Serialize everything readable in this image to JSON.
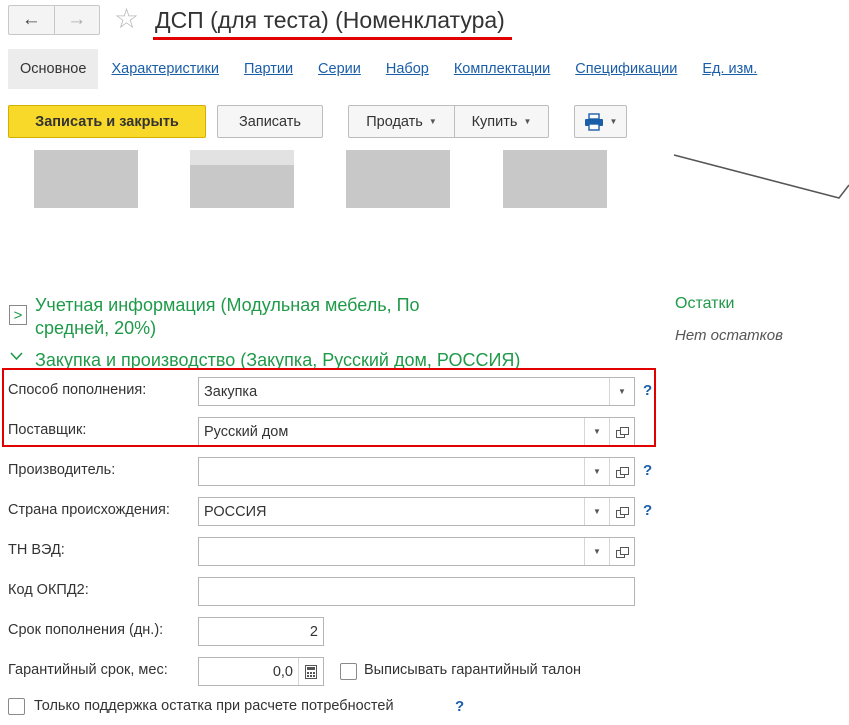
{
  "header": {
    "title": "ДСП (для теста) (Номенклатура)",
    "back_icon": "←",
    "forward_icon": "→",
    "star_icon": "☆"
  },
  "tabs": [
    {
      "label": "Основное",
      "active": true
    },
    {
      "label": "Характеристики"
    },
    {
      "label": "Партии"
    },
    {
      "label": "Серии"
    },
    {
      "label": "Набор"
    },
    {
      "label": "Комплектации"
    },
    {
      "label": "Спецификации"
    },
    {
      "label": "Ед. изм."
    }
  ],
  "toolbar": {
    "save_close": "Записать и закрыть",
    "save": "Записать",
    "sell": "Продать",
    "buy": "Купить",
    "print_icon": "🖶",
    "dropdown_glyph": "▼"
  },
  "sections": {
    "accounting": {
      "title_line1": "Учетная информация (Модульная мебель, По",
      "title_line2": "средней, 20%)",
      "collapsed": true
    },
    "purchase": {
      "title": "Закупка и производство (Закупка, Русский дом, РОССИЯ)",
      "collapsed": false
    }
  },
  "fields": {
    "replenishment_method": {
      "label": "Способ пополнения:",
      "value": "Закупка"
    },
    "supplier": {
      "label": "Поставщик:",
      "value": "Русский дом"
    },
    "manufacturer": {
      "label": "Производитель:",
      "value": ""
    },
    "country": {
      "label": "Страна происхождения:",
      "value": "РОССИЯ"
    },
    "tn_ved": {
      "label": "ТН ВЭД:",
      "value": ""
    },
    "okpd2": {
      "label": "Код ОКПД2:",
      "value": ""
    },
    "replenishment_term": {
      "label": "Срок пополнения (дн.):",
      "value": "2"
    },
    "warranty": {
      "label": "Гарантийный срок, мес:",
      "value": "0,0"
    }
  },
  "checkboxes": {
    "warranty_ticket": {
      "label": "Выписывать гарантийный талон",
      "checked": false
    },
    "stock_support": {
      "label": "Только поддержка остатка при расчете потребностей",
      "checked": false
    }
  },
  "help_glyph": "?",
  "right_panel": {
    "title": "Остатки",
    "empty_text": "Нет остатков"
  },
  "colors": {
    "accent_green": "#1f9a49",
    "link_blue": "#1b5ea8",
    "primary_yellow": "#f8d92a",
    "highlight_red": "#e00000"
  }
}
